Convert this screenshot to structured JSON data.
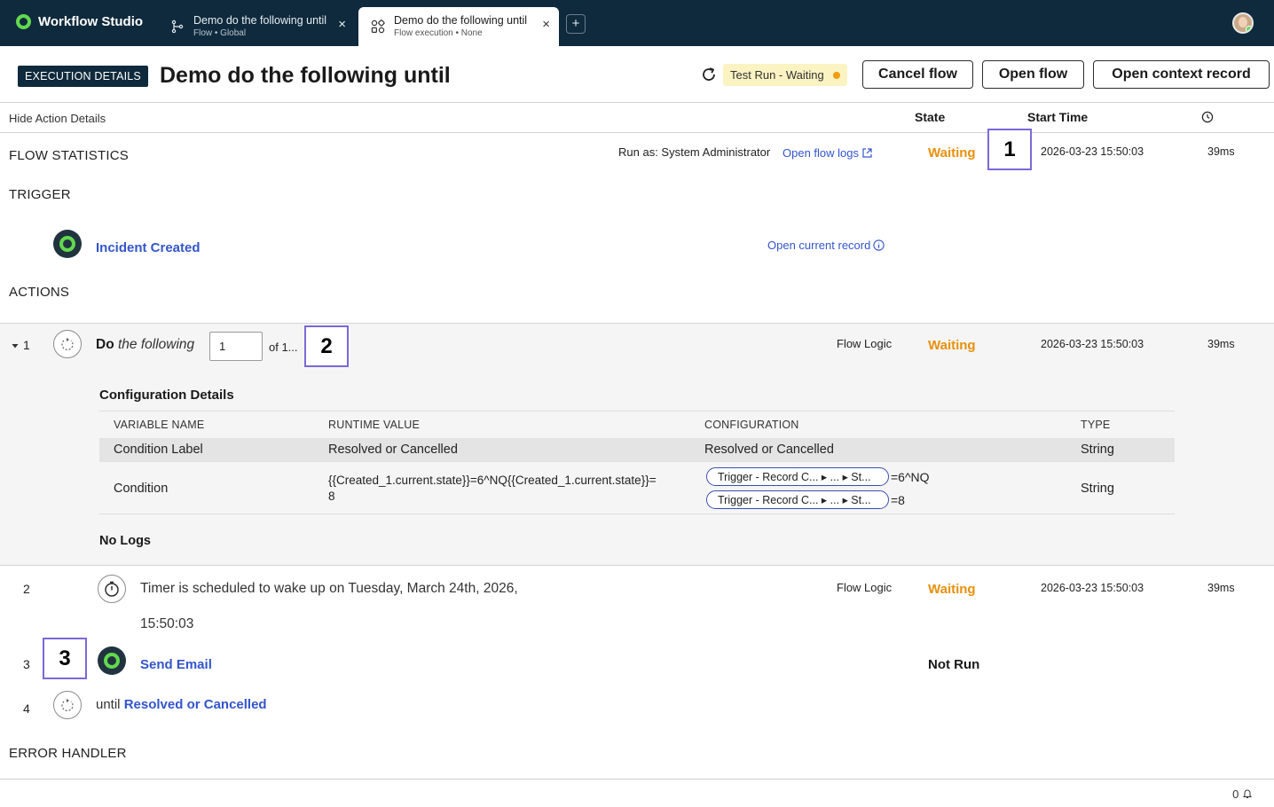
{
  "app": {
    "name": "Workflow Studio"
  },
  "tabs": [
    {
      "title": "Demo do the following until",
      "subtitle": "Flow • Global",
      "close": "×"
    },
    {
      "title": "Demo do the following until",
      "subtitle": "Flow execution • None",
      "close": "×"
    }
  ],
  "new_tab_label": "+",
  "header": {
    "badge": "EXECUTION DETAILS",
    "title": "Demo do the following until",
    "status": "Test Run - Waiting",
    "cancel_label": "Cancel flow",
    "open_flow_label": "Open flow",
    "open_context_label": "Open context record"
  },
  "columns": {
    "hide_details": "Hide Action Details",
    "state": "State",
    "start_time": "Start Time"
  },
  "flow_statistics": {
    "label": "FLOW STATISTICS",
    "run_as": "Run as: System Administrator",
    "logs_link": "Open flow logs",
    "state": "Waiting",
    "start_time": "2026-03-23 15:50:03",
    "duration": "39ms"
  },
  "trigger": {
    "label": "TRIGGER",
    "name": "Incident Created",
    "open_record": "Open current record"
  },
  "actions_label": "ACTIONS",
  "action1": {
    "num": "1",
    "do": "Do",
    "following": "the following",
    "iteration": "1",
    "of": "of 1...",
    "type": "Flow Logic",
    "state": "Waiting",
    "start_time": "2026-03-23 15:50:03",
    "duration": "39ms",
    "config_title": "Configuration Details",
    "config_headers": [
      "VARIABLE NAME",
      "RUNTIME VALUE",
      "CONFIGURATION",
      "TYPE"
    ],
    "config_rows": [
      {
        "name": "Condition Label",
        "runtime": "Resolved or Cancelled",
        "config": "Resolved or Cancelled",
        "type": "String"
      },
      {
        "name": "Condition",
        "runtime_1": "{{Created_1.current.state}}=6^NQ{{Created_1.current.state}}=",
        "runtime_2": "8",
        "pill": "Trigger - Record C...  ▸  ...  ▸ St...",
        "suffix_1": "=6^NQ",
        "suffix_2": "=8",
        "type": "String"
      }
    ],
    "no_logs": "No Logs"
  },
  "action2": {
    "num": "2",
    "text_1": "Timer is scheduled to wake up on Tuesday, March 24th, 2026,",
    "text_2": "15:50:03",
    "type": "Flow Logic",
    "state": "Waiting",
    "start_time": "2026-03-23 15:50:03",
    "duration": "39ms"
  },
  "action3": {
    "num": "3",
    "name": "Send Email",
    "state": "Not Run"
  },
  "action4": {
    "num": "4",
    "until": "until",
    "condition": "Resolved or Cancelled"
  },
  "error_handler_label": "ERROR HANDLER",
  "markers": [
    "1",
    "2",
    "3"
  ],
  "footer": {
    "notifications": "0"
  },
  "colors": {
    "topbar": "#0f2a3c",
    "accent_green": "#62d84e",
    "waiting": "#e8900c",
    "link": "#3355cc",
    "marker": "#7a69d8"
  }
}
